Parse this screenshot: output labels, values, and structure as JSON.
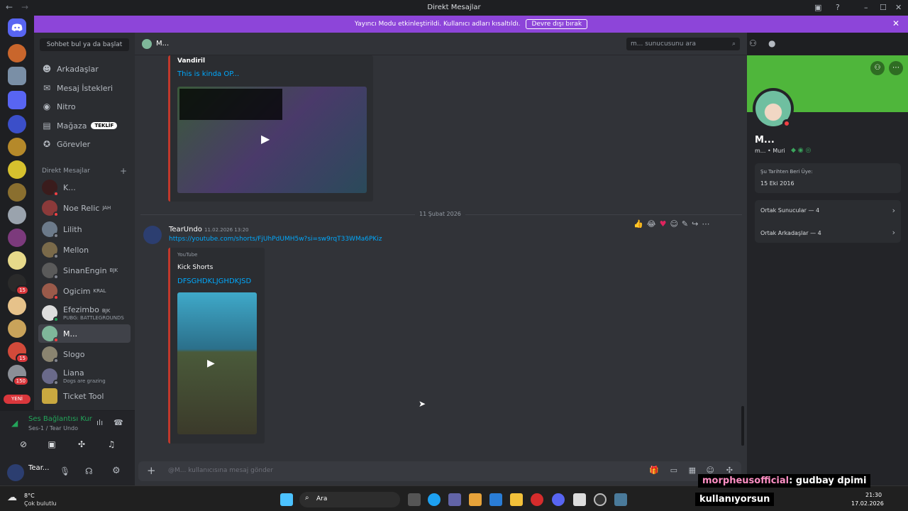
{
  "window": {
    "title": "Direkt Mesajlar"
  },
  "banner": {
    "text": "Yayıncı Modu etkinleştirildi. Kullanıcı adları kısaltıldı.",
    "button": "Devre dışı bırak"
  },
  "sidebar": {
    "search_label": "Sohbet bul ya da başlat",
    "nav": [
      {
        "label": "Arkadaşlar",
        "icon": "friends-icon"
      },
      {
        "label": "Mesaj İstekleri",
        "icon": "mail-icon"
      },
      {
        "label": "Nitro",
        "icon": "nitro-icon"
      },
      {
        "label": "Mağaza",
        "icon": "shop-icon",
        "badge": "TEKLİF"
      },
      {
        "label": "Görevler",
        "icon": "quests-icon"
      }
    ],
    "dm_header": "Direkt Mesajlar",
    "dms": [
      {
        "name": "K...",
        "tag": "",
        "sub": ""
      },
      {
        "name": "Noe Relic",
        "tag": "JAH",
        "sub": ""
      },
      {
        "name": "Lilith",
        "tag": "",
        "sub": ""
      },
      {
        "name": "Mellon",
        "tag": "",
        "sub": ""
      },
      {
        "name": "SinanEngin",
        "tag": "BJK",
        "sub": ""
      },
      {
        "name": "Ogicim",
        "tag": "KRAL",
        "sub": ""
      },
      {
        "name": "Efezimbo",
        "tag": "BJK",
        "sub": "PUBG: BATTLEGROUNDS"
      },
      {
        "name": "M...",
        "tag": "",
        "sub": ""
      },
      {
        "name": "Slogo",
        "tag": "",
        "sub": ""
      },
      {
        "name": "Liana",
        "tag": "",
        "sub": "Dogs are grazing"
      },
      {
        "name": "Ticket Tool",
        "tag": "",
        "sub": ""
      }
    ],
    "new_badge": "YENİ",
    "server_badges": [
      "15",
      "15",
      "150"
    ]
  },
  "voice": {
    "status": "Ses Bağlantısı Kur",
    "channel": "Ses-1 / Tear Undo"
  },
  "user": {
    "name": "Tear..."
  },
  "chat": {
    "header_name": "M...",
    "search_placeholder": "m... sunucusunu ara",
    "embed1": {
      "author": "Vandiril",
      "title": "This is kinda OP..."
    },
    "date_divider": "11 Şubat 2026",
    "message": {
      "author": "TearUndo",
      "time": "11.02.2026 13:20",
      "link": "https://youtube.com/shorts/FjUhPdUMH5w?si=sw9rqT33WMa6PKiz",
      "embed": {
        "provider": "YouTube",
        "author": "Kick Shorts",
        "title": "DFSGHDKLJGHDKJSD"
      }
    },
    "input_placeholder": "@M... kullanıcısına mesaj gönder"
  },
  "profile": {
    "name": "M...",
    "handle": "m... • Muri",
    "member_since_label": "Şu Tarihten Beri Üye:",
    "member_since": "15 Eki 2016",
    "mutual_servers": "Ortak Sunucular — 4",
    "mutual_friends": "Ortak Arkadaşlar — 4"
  },
  "taskbar": {
    "weather_temp": "8°C",
    "weather_desc": "Çok bulutlu",
    "search": "Ara",
    "time": "21:30",
    "date": "17.02.2026"
  },
  "stream_chat": {
    "user": "morpheusofficial",
    "msg1": ": gudbay dpimi",
    "msg2": "kullanıyorsun"
  },
  "colors": {
    "banner": "#8d45d9",
    "profile_banner": "#4fb63b",
    "accent": "#5865f2",
    "link": "#00a8fc"
  }
}
